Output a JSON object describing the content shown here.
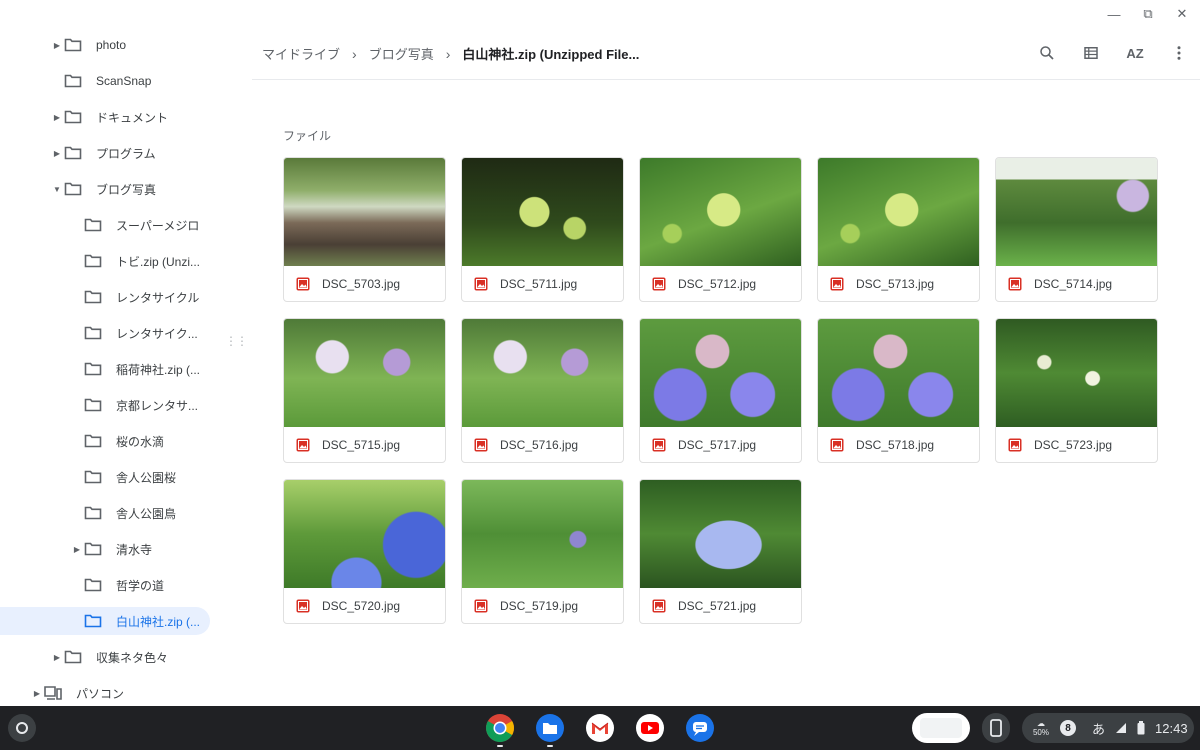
{
  "window": {
    "minimize": "—",
    "restore": "⧉",
    "close": "✕"
  },
  "sidebar": {
    "items": [
      {
        "label": "photo",
        "arrow": "right"
      },
      {
        "label": "ScanSnap",
        "arrow": ""
      },
      {
        "label": "ドキュメント",
        "arrow": "right"
      },
      {
        "label": "プログラム",
        "arrow": "right"
      },
      {
        "label": "ブログ写真",
        "arrow": "down"
      },
      {
        "label": "スーパーメジロ",
        "arrow": ""
      },
      {
        "label": "トビ.zip (Unzi...",
        "arrow": ""
      },
      {
        "label": "レンタサイクル",
        "arrow": ""
      },
      {
        "label": "レンタサイク...",
        "arrow": ""
      },
      {
        "label": "稲荷神社.zip (...",
        "arrow": ""
      },
      {
        "label": "京都レンタサ...",
        "arrow": ""
      },
      {
        "label": "桜の水滴",
        "arrow": ""
      },
      {
        "label": "舎人公園桜",
        "arrow": ""
      },
      {
        "label": "舎人公園鳥",
        "arrow": ""
      },
      {
        "label": "清水寺",
        "arrow": "right"
      },
      {
        "label": "哲学の道",
        "arrow": ""
      },
      {
        "label": "白山神社.zip (...",
        "arrow": "",
        "selected": true
      },
      {
        "label": "収集ネタ色々",
        "arrow": "right"
      },
      {
        "label": "パソコン",
        "arrow": "right",
        "icon": "computer-icon"
      }
    ]
  },
  "header": {
    "breadcrumb": [
      "マイドライブ",
      "ブログ写真",
      "白山神社.zip (Unzipped File..."
    ],
    "tools": [
      "search-icon",
      "list-view-icon",
      "sort-az-icon",
      "more-vert-icon"
    ],
    "sort_label": "AZ"
  },
  "main": {
    "section_label": "ファイル",
    "files": [
      {
        "name": "DSC_5703.jpg",
        "theme": "shrine"
      },
      {
        "name": "DSC_5711.jpg",
        "theme": "green-dark"
      },
      {
        "name": "DSC_5712.jpg",
        "theme": "green"
      },
      {
        "name": "DSC_5713.jpg",
        "theme": "green"
      },
      {
        "name": "DSC_5714.jpg",
        "theme": "garden"
      },
      {
        "name": "DSC_5715.jpg",
        "theme": "garden-purple"
      },
      {
        "name": "DSC_5716.jpg",
        "theme": "garden-purple"
      },
      {
        "name": "DSC_5717.jpg",
        "theme": "blue-flower"
      },
      {
        "name": "DSC_5718.jpg",
        "theme": "blue-flower"
      },
      {
        "name": "DSC_5723.jpg",
        "theme": "leafy"
      },
      {
        "name": "DSC_5720.jpg",
        "theme": "hydrangea"
      },
      {
        "name": "DSC_5719.jpg",
        "theme": "leafy-small"
      },
      {
        "name": "DSC_5721.jpg",
        "theme": "hydrangea-center"
      }
    ]
  },
  "shelf": {
    "apps": [
      "chrome-icon",
      "files-icon",
      "gmail-icon",
      "youtube-icon",
      "messages-icon"
    ],
    "battery_label": "50%",
    "notification_count": "8",
    "ime": "あ",
    "time": "12:43"
  },
  "colors": {
    "accent": "#1a73e8",
    "selected_bg": "#e8f0fe",
    "shelf": "#202124",
    "image_icon": "#d93025"
  }
}
